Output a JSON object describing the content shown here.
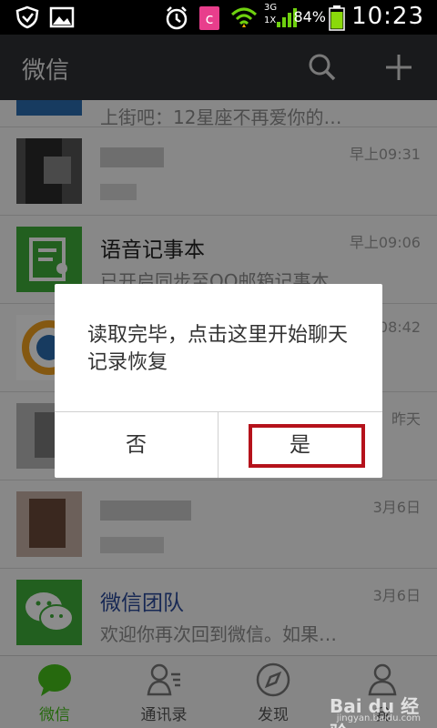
{
  "status_bar": {
    "time": "10:23",
    "battery_percent": "84%",
    "network_label_top": "3G",
    "network_label_bottom": "1X",
    "icons": [
      "shield-icon",
      "image-icon",
      "alarm-clock-icon",
      "app-c-icon",
      "wifi-icon",
      "signal-icon",
      "battery-icon"
    ]
  },
  "header": {
    "title": "微信",
    "icons": [
      "search-icon",
      "plus-icon"
    ]
  },
  "chats": [
    {
      "name": "",
      "time": "",
      "preview": "上街吧：12星座不再爱你的…",
      "avatar_color": "#2b6cb0"
    },
    {
      "name": "",
      "time": "早上09:31",
      "preview": "",
      "avatar_color": "#444444"
    },
    {
      "name": "语音记事本",
      "time": "早上09:06",
      "preview": "已开启同步至QQ邮箱记事本…",
      "avatar_color": "#3fae3a"
    },
    {
      "name": "",
      "time": "08:42",
      "preview": "",
      "avatar_color": "#f0a020"
    },
    {
      "name": "",
      "time": "昨天",
      "preview": "",
      "avatar_color": "#8a8a8a"
    },
    {
      "name": "",
      "time": "3月6日",
      "preview": "",
      "avatar_color": "#9a7a6a"
    },
    {
      "name": "微信团队",
      "time": "3月6日",
      "preview": "欢迎你再次回到微信。如果…",
      "avatar_color": "#3fae3a"
    }
  ],
  "dialog": {
    "message": "读取完毕，点击这里开始聊天记录恢复",
    "no_label": "否",
    "yes_label": "是"
  },
  "tabs": [
    {
      "label": "微信",
      "icon": "chat-bubble-icon",
      "active": true
    },
    {
      "label": "通讯录",
      "icon": "contacts-icon",
      "active": false
    },
    {
      "label": "发现",
      "icon": "compass-icon",
      "active": false
    },
    {
      "label": "我",
      "icon": "person-icon",
      "active": false
    }
  ],
  "colors": {
    "accent": "#45c01a",
    "header_bg": "#2f3134",
    "highlight_border": "#b5121b"
  },
  "watermark": {
    "brand": "Bai du 经验",
    "url": "jingyan.baidu.com"
  }
}
